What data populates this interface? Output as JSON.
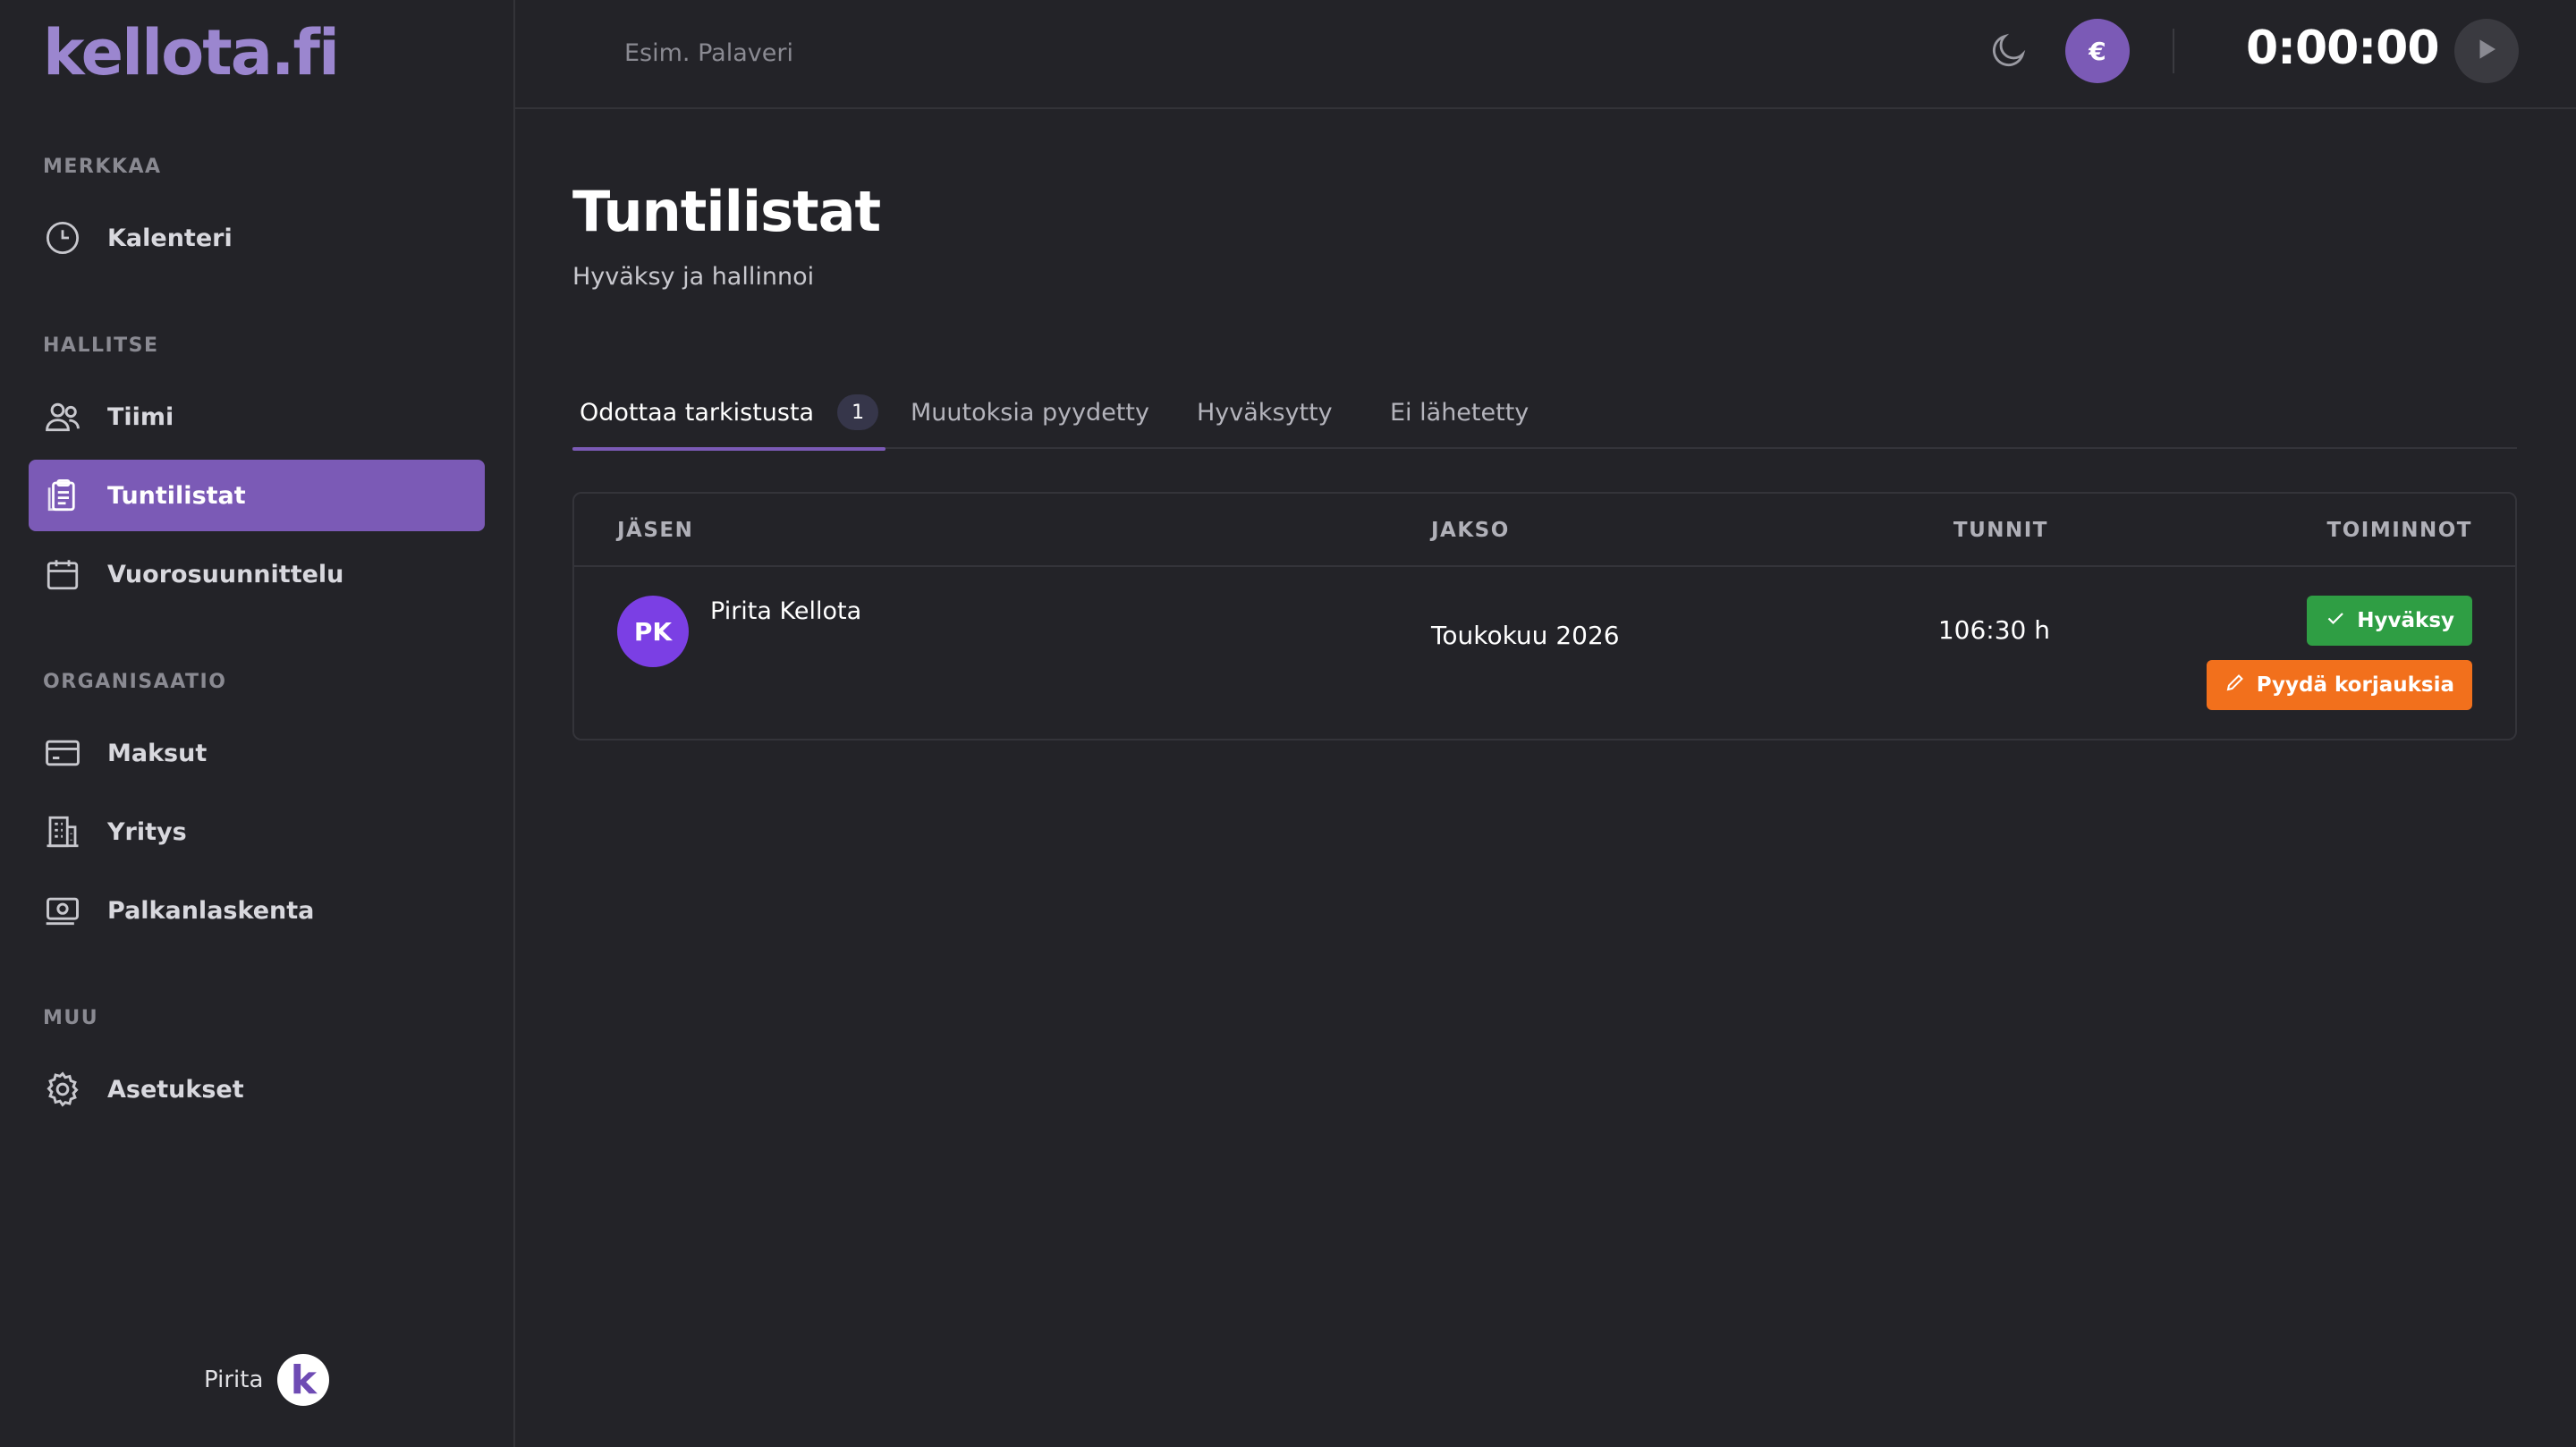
{
  "brand": {
    "logo_text": "kellota.fi"
  },
  "sidebar": {
    "sections": [
      {
        "title": "MERKKAA"
      },
      {
        "title": "HALLITSE"
      },
      {
        "title": "ORGANISAATIO"
      },
      {
        "title": "MUU"
      }
    ],
    "items": [
      {
        "label": "Kalenteri",
        "icon": "clock-icon"
      },
      {
        "label": "Tiimi",
        "icon": "users-icon"
      },
      {
        "label": "Tuntilistat",
        "icon": "clipboard-icon",
        "active": true
      },
      {
        "label": "Vuorosuunnittelu",
        "icon": "calendar-icon"
      },
      {
        "label": "Maksut",
        "icon": "credit-card-icon"
      },
      {
        "label": "Yritys",
        "icon": "building-icon"
      },
      {
        "label": "Palkanlaskenta",
        "icon": "money-icon"
      },
      {
        "label": "Asetukset",
        "icon": "gear-icon"
      }
    ],
    "user": {
      "name": "Pirita",
      "logo_letter": "k"
    }
  },
  "topbar": {
    "task_placeholder": "Esim. Palaveri",
    "currency_symbol": "€",
    "timer": "0:00:00"
  },
  "page": {
    "title": "Tuntilistat",
    "subtitle": "Hyväksy ja hallinnoi"
  },
  "tabs": [
    {
      "label": "Odottaa tarkistusta",
      "badge": "1",
      "active": true
    },
    {
      "label": "Muutoksia pyydetty"
    },
    {
      "label": "Hyväksytty"
    },
    {
      "label": "Ei lähetetty"
    }
  ],
  "table": {
    "columns": [
      "JÄSEN",
      "JAKSO",
      "TUNNIT",
      "TOIMINNOT"
    ],
    "rows": [
      {
        "initials": "PK",
        "member": "Pirita Kellota",
        "period": "Toukokuu 2026",
        "hours": "106:30 h",
        "approve_label": "Hyväksy",
        "request_label": "Pyydä korjauksia"
      }
    ]
  },
  "colors": {
    "accent": "#7b5ab6",
    "approve": "#2f9e44",
    "request": "#f2701c",
    "background": "#232328"
  }
}
